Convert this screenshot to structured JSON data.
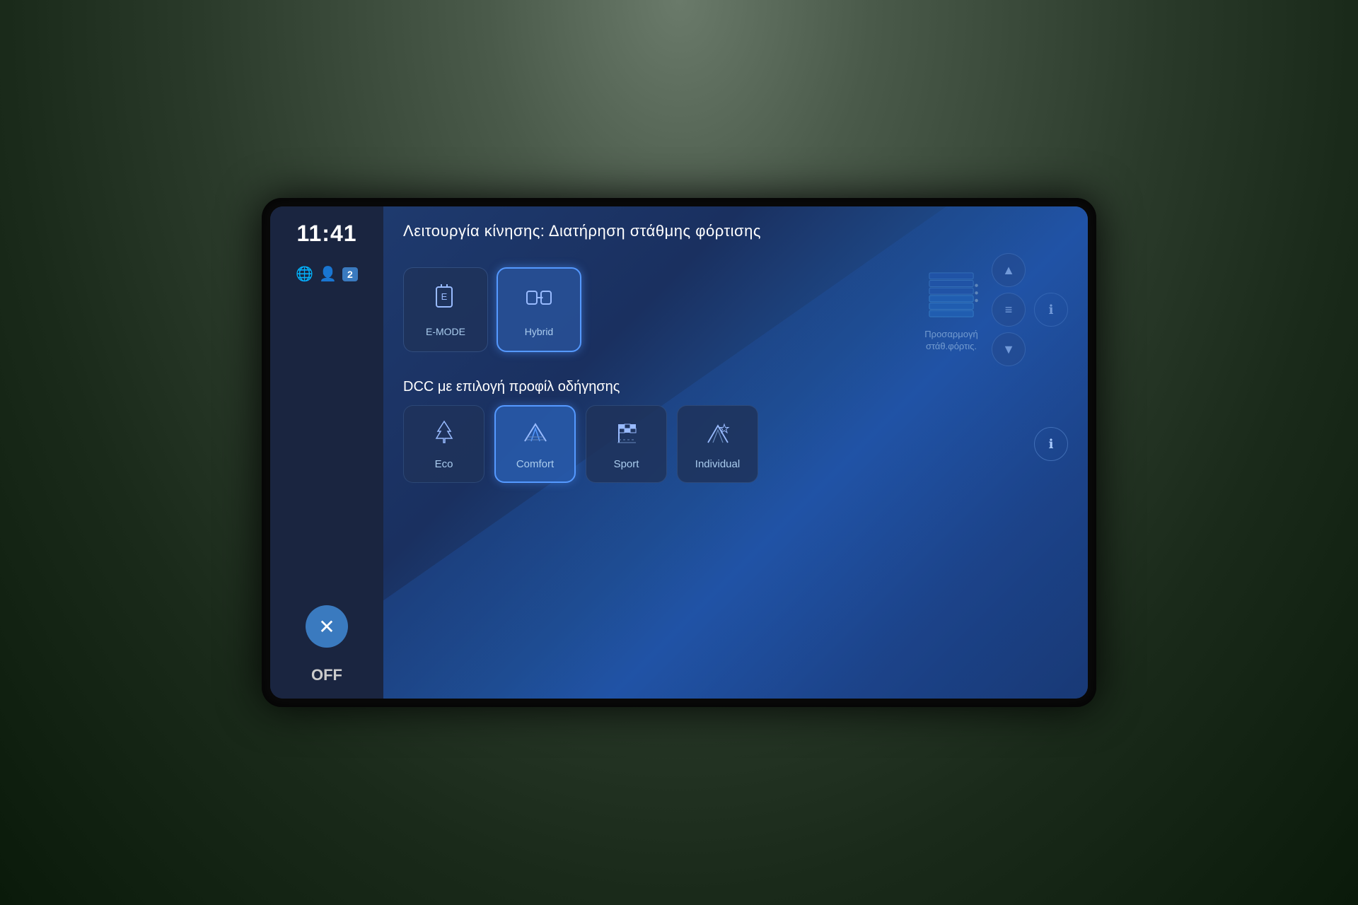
{
  "screen": {
    "time": "11:41",
    "notification_count": "2",
    "off_label": "OFF",
    "close_icon": "✕"
  },
  "drive_section": {
    "title": "Λειτουργία κίνησης: Διατήρηση στάθμης φόρτισης",
    "modes": [
      {
        "id": "emode",
        "label": "E-MODE",
        "icon": "⊟",
        "active": false
      },
      {
        "id": "hybrid",
        "label": "Hybrid",
        "icon": "⇒",
        "active": true
      }
    ],
    "charge_adapt": {
      "label": "Προσαρμογή\nστάθ.φόρτις.",
      "icon": "battery-stack"
    },
    "scroll_up_label": "▲",
    "scroll_mid_label": "≡",
    "scroll_down_label": "▼",
    "info_label": "ℹ"
  },
  "dcc_section": {
    "title": "DCC με επιλογή προφίλ οδήγησης",
    "modes": [
      {
        "id": "eco",
        "label": "Eco",
        "icon": "eco",
        "active": false
      },
      {
        "id": "comfort",
        "label": "Comfort",
        "icon": "comfort",
        "active": true
      },
      {
        "id": "sport",
        "label": "Sport",
        "icon": "sport",
        "active": false
      },
      {
        "id": "individual",
        "label": "Individual",
        "icon": "individual",
        "active": false
      }
    ],
    "info_label": "ℹ"
  },
  "colors": {
    "active_border": "#5599ff",
    "inactive_bg": "rgba(30,50,90,0.85)",
    "text_primary": "#ffffff",
    "text_secondary": "#aaccee",
    "accent_blue": "#3a7abf"
  }
}
